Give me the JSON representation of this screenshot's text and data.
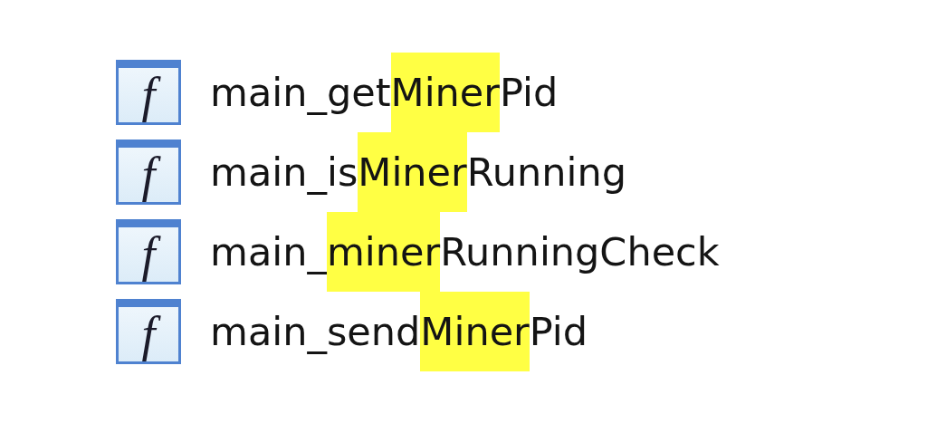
{
  "functions": [
    {
      "icon_glyph": "f",
      "before": "main_get",
      "match": "Miner",
      "after": "Pid"
    },
    {
      "icon_glyph": "f",
      "before": "main_is",
      "match": "Miner",
      "after": "Running"
    },
    {
      "icon_glyph": "f",
      "before": "main_",
      "match": "miner",
      "after": "RunningCheck"
    },
    {
      "icon_glyph": "f",
      "before": "main_send",
      "match": "Miner",
      "after": "Pid"
    }
  ]
}
